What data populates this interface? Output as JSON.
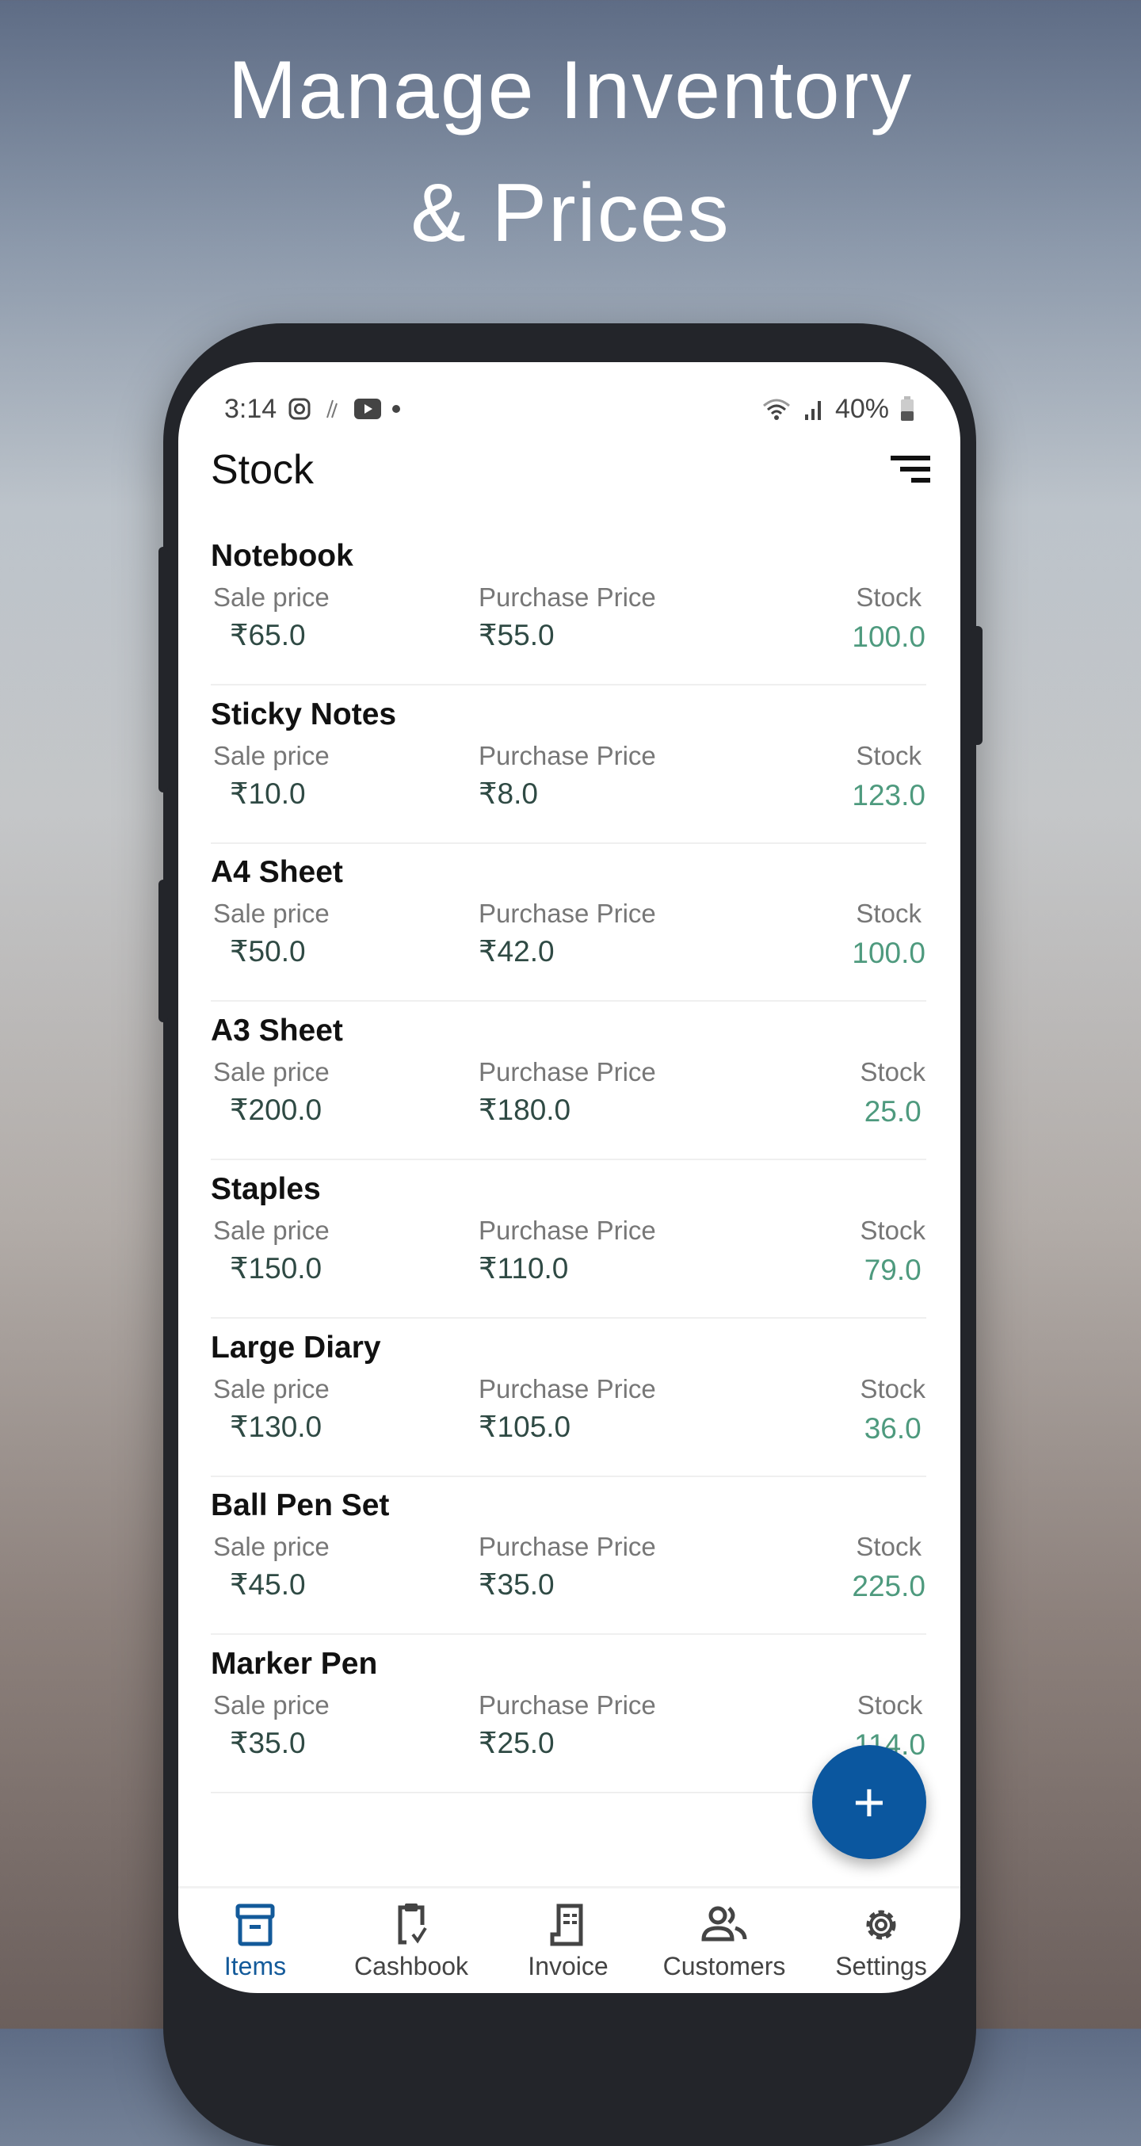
{
  "headline": {
    "line1": "Manage Inventory",
    "line2": "& Prices"
  },
  "status_bar": {
    "time": "3:14",
    "battery": "40%",
    "icons": [
      "instagram-icon",
      "app-icon",
      "youtube-icon",
      "dot-icon",
      "wifi-icon",
      "signal-icon",
      "battery-icon"
    ]
  },
  "header": {
    "title": "Stock",
    "filter_icon": "sort-icon"
  },
  "labels": {
    "sale": "Sale price",
    "purchase": "Purchase Price",
    "stock": "Stock"
  },
  "items": [
    {
      "name": "Notebook",
      "sale": "₹65.0",
      "purchase": "₹55.0",
      "stock": "100.0"
    },
    {
      "name": "Sticky Notes",
      "sale": "₹10.0",
      "purchase": "₹8.0",
      "stock": "123.0"
    },
    {
      "name": "A4 Sheet",
      "sale": "₹50.0",
      "purchase": "₹42.0",
      "stock": "100.0"
    },
    {
      "name": "A3 Sheet",
      "sale": "₹200.0",
      "purchase": "₹180.0",
      "stock": "25.0"
    },
    {
      "name": "Staples",
      "sale": "₹150.0",
      "purchase": "₹110.0",
      "stock": "79.0"
    },
    {
      "name": "Large Diary",
      "sale": "₹130.0",
      "purchase": "₹105.0",
      "stock": "36.0"
    },
    {
      "name": "Ball Pen Set",
      "sale": "₹45.0",
      "purchase": "₹35.0",
      "stock": "225.0"
    },
    {
      "name": "Marker Pen",
      "sale": "₹35.0",
      "purchase": "₹25.0",
      "stock": "114.0"
    }
  ],
  "fab": {
    "label": "+"
  },
  "nav": [
    {
      "label": "Items",
      "icon": "archive-box-icon",
      "active": true
    },
    {
      "label": "Cashbook",
      "icon": "clipboard-check-icon"
    },
    {
      "label": "Invoice",
      "icon": "receipt-icon"
    },
    {
      "label": "Customers",
      "icon": "users-icon"
    },
    {
      "label": "Settings",
      "icon": "gear-icon"
    }
  ],
  "colors": {
    "accent": "#0b579f",
    "stock_value": "#4e9a7e",
    "price_value": "#2f4a44"
  }
}
